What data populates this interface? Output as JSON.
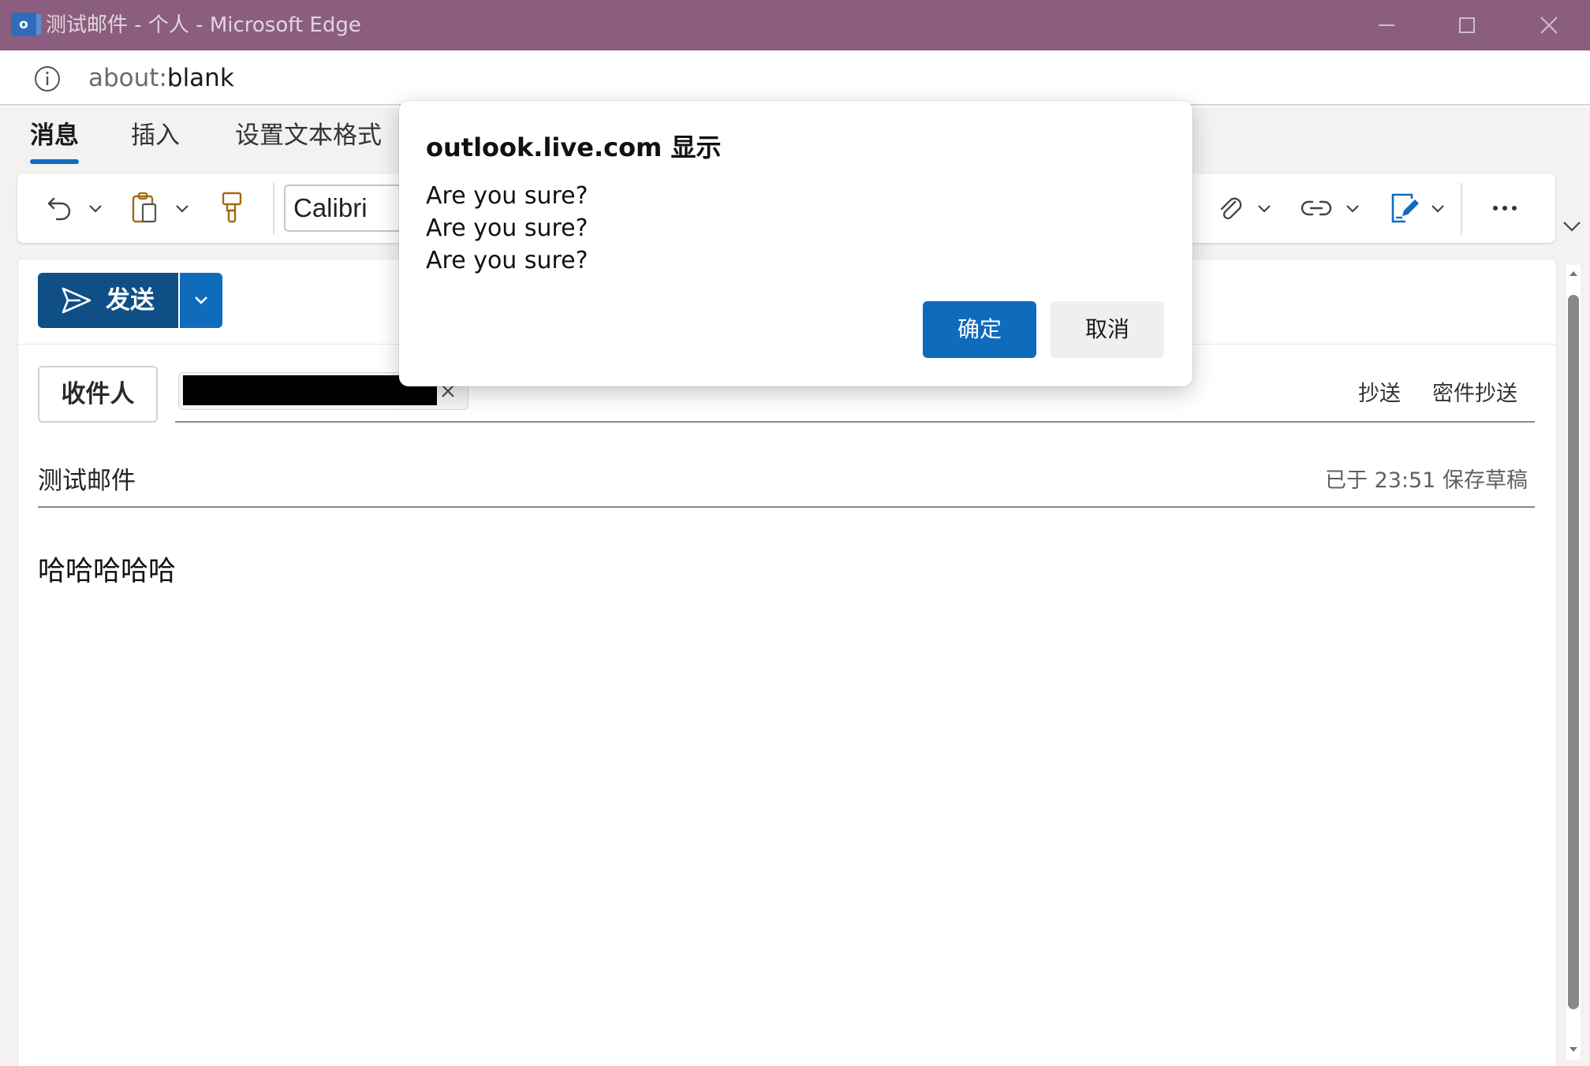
{
  "window": {
    "title": "测试邮件 - 个人 - Microsoft Edge",
    "logo_text": "o",
    "titlebar_color": "#8b5e7f"
  },
  "address": {
    "url_prefix": "about:",
    "url_main": "blank"
  },
  "tabs": [
    {
      "label": "消息",
      "active": true
    },
    {
      "label": "插入",
      "active": false
    },
    {
      "label": "设置文本格式",
      "active": false
    }
  ],
  "ribbon": {
    "font_name": "Calibri",
    "icons": [
      "undo-icon",
      "paste-icon",
      "format-painter-icon",
      "attach-icon",
      "link-icon",
      "signature-icon",
      "more-icon"
    ]
  },
  "compose": {
    "send_label": "发送",
    "to_label": "收件人",
    "cc_label": "抄送",
    "bcc_label": "密件抄送",
    "subject": "测试邮件",
    "save_status": "已于 23:51 保存草稿",
    "body": "哈哈哈哈哈"
  },
  "dialog": {
    "title": "outlook.live.com 显示",
    "message": "Are you sure?\nAre you sure?\nAre you sure?",
    "ok_label": "确定",
    "cancel_label": "取消"
  },
  "colors": {
    "accent": "#0f6cbd",
    "send_dark": "#0f4f86"
  }
}
